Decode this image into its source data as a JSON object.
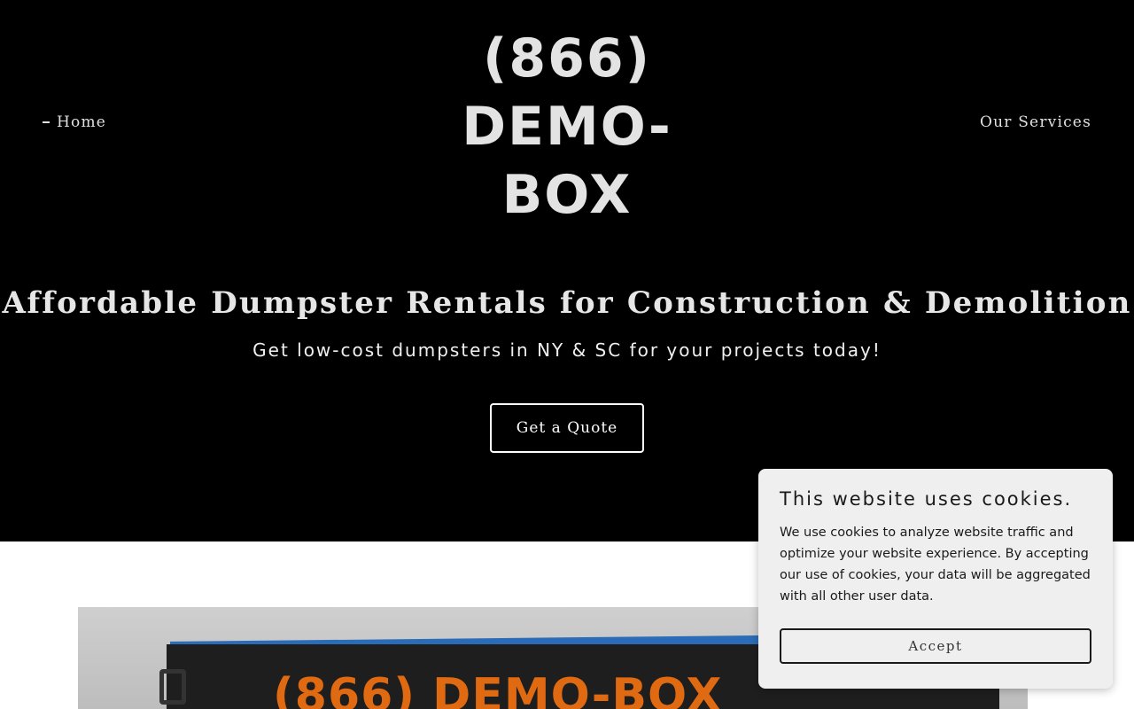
{
  "nav": {
    "home_label": "Home",
    "services_label": "Our Services"
  },
  "logo": {
    "line1": "(866)",
    "line2": "DEMO-",
    "line3": "BOX"
  },
  "hero": {
    "headline": "Affordable Dumpster Rentals for Construction & Demolition",
    "subheadline": "Get low-cost dumpsters in NY & SC for your projects today!",
    "cta_label": "Get a Quote"
  },
  "photo": {
    "dumpster_text": "(866) DEMO-BOX"
  },
  "cookie_banner": {
    "title": "This website uses cookies.",
    "body": "We use cookies to analyze website traffic and optimize your website experience. By accepting our use of cookies, your data will be aggregated with all other user data.",
    "accept_label": "Accept"
  },
  "colors": {
    "hero_background": "#000000",
    "text_light": "#e6e6e6",
    "banner_background": "#efefef",
    "accent_orange": "#e06a12",
    "rim_blue": "#2b6cb8"
  }
}
